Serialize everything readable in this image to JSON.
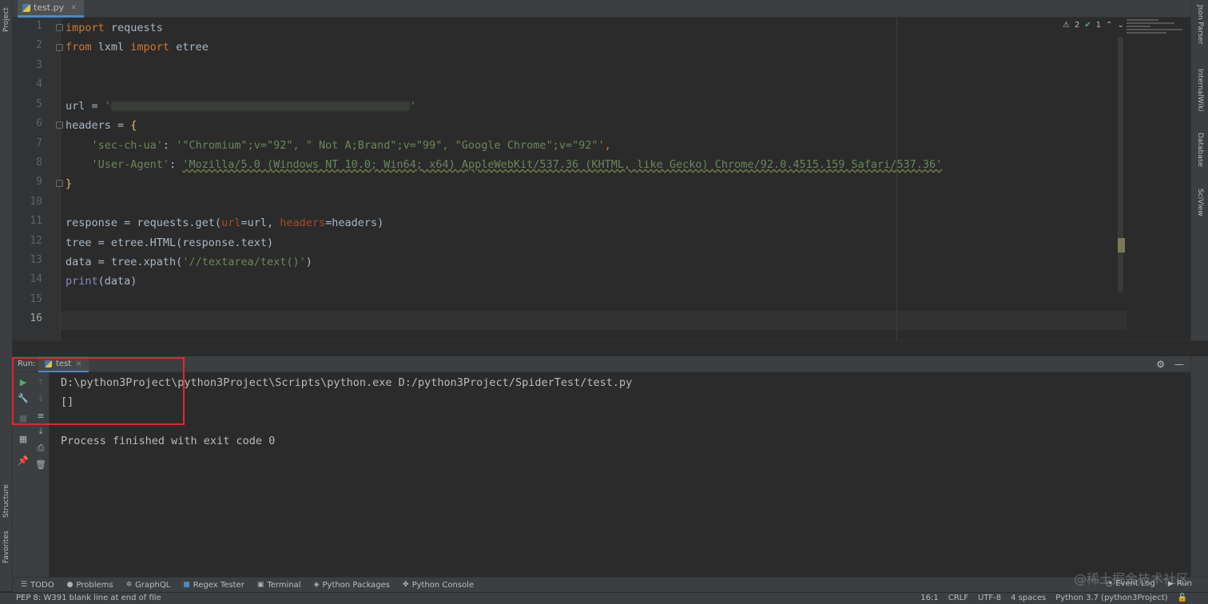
{
  "left_strip": {
    "project": "Project",
    "structure": "Structure",
    "favorites": "Favorites"
  },
  "right_strip": {
    "json_parser": "Json Parser",
    "internal_wiki": "InternalWiki",
    "database": "Database",
    "sciview": "SciView"
  },
  "editor_tab": {
    "name": "test.py",
    "close": "×"
  },
  "inspections": {
    "warnings": "2",
    "ok": "1"
  },
  "editor": {
    "line_numbers": [
      "1",
      "2",
      "3",
      "4",
      "5",
      "6",
      "7",
      "8",
      "9",
      "10",
      "11",
      "12",
      "13",
      "14",
      "15",
      "16"
    ],
    "lines": {
      "l1_kw": "import",
      "l1_rest": " requests",
      "l2_kw1": "from",
      "l2_mid": " lxml ",
      "l2_kw2": "import",
      "l2_rest": " etree",
      "l5_a": "url = ",
      "l5_q1": "'",
      "l5_q2": "'",
      "l6_a": "headers = ",
      "l6_brace": "{",
      "l7_indent": "    ",
      "l7_key": "'sec-ch-ua'",
      "l7_colon": ": ",
      "l7_val": "'\"Chromium\";v=\"92\", \" Not A;Brand\";v=\"99\", \"Google Chrome\";v=\"92\"'",
      "l7_comma": ",",
      "l8_indent": "    ",
      "l8_key": "'User-Agent'",
      "l8_colon": ": ",
      "l8_val": "'Mozilla/5.0 (Windows NT 10.0; Win64; x64) AppleWebKit/537.36 (KHTML, like Gecko) Chrome/92.0.4515.159 Safari/537.36'",
      "l9_brace": "}",
      "l11_a": "response = requests.get(",
      "l11_p1": "url",
      "l11_b": "=url, ",
      "l11_p2": "headers",
      "l11_c": "=headers)",
      "l12": "tree = etree.HTML(response.text)",
      "l13_a": "data = tree.xpath(",
      "l13_str": "'//textarea/text()'",
      "l13_b": ")",
      "l14_fn": "print",
      "l14_rest": "(data)"
    }
  },
  "run": {
    "label": "Run:",
    "tab": "test",
    "tab_close": "×",
    "output": [
      "D:\\python3Project\\python3Project\\Scripts\\python.exe D:/python3Project/SpiderTest/test.py",
      "[]",
      "",
      "Process finished with exit code 0"
    ]
  },
  "toolbar": {
    "todo": "TODO",
    "problems": "Problems",
    "graphql": "GraphQL",
    "regex": "Regex Tester",
    "terminal": "Terminal",
    "packages": "Python Packages",
    "console": "Python Console",
    "event_log": "Event Log",
    "run": "Run"
  },
  "status": {
    "message": "PEP 8: W391 blank line at end of file",
    "position": "16:1",
    "line_sep": "CRLF",
    "encoding": "UTF-8",
    "indent": "4 spaces",
    "interpreter": "Python 3.7 (python3Project)"
  },
  "watermark": "@稀土掘金技术社区",
  "colors": {
    "keyword": "#cc7832",
    "string": "#6a8759",
    "param": "#aa4926",
    "builtin": "#8888c6",
    "highlight_box": "#e0272e"
  }
}
